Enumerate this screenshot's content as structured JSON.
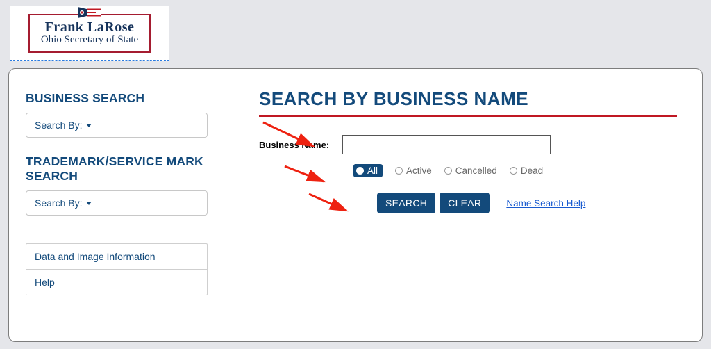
{
  "header": {
    "logo_name": "Frank LaRose",
    "logo_subtitle": "Ohio Secretary of State"
  },
  "sidebar": {
    "business_search_heading": "BUSINESS SEARCH",
    "business_dropdown_label": "Search By:",
    "trademark_heading": "TRADEMARK/SERVICE MARK SEARCH",
    "trademark_dropdown_label": "Search By:",
    "links": {
      "data_image": "Data and Image Information",
      "help": "Help"
    }
  },
  "main": {
    "title": "SEARCH BY BUSINESS NAME",
    "field_label": "Business Name:",
    "field_value": "",
    "filters": {
      "all": "All",
      "active": "Active",
      "cancelled": "Cancelled",
      "dead": "Dead",
      "selected": "all"
    },
    "buttons": {
      "search": "SEARCH",
      "clear": "CLEAR"
    },
    "help_link": "Name Search Help"
  },
  "colors": {
    "brand_blue": "#134a7b",
    "accent_red": "#c01823"
  }
}
